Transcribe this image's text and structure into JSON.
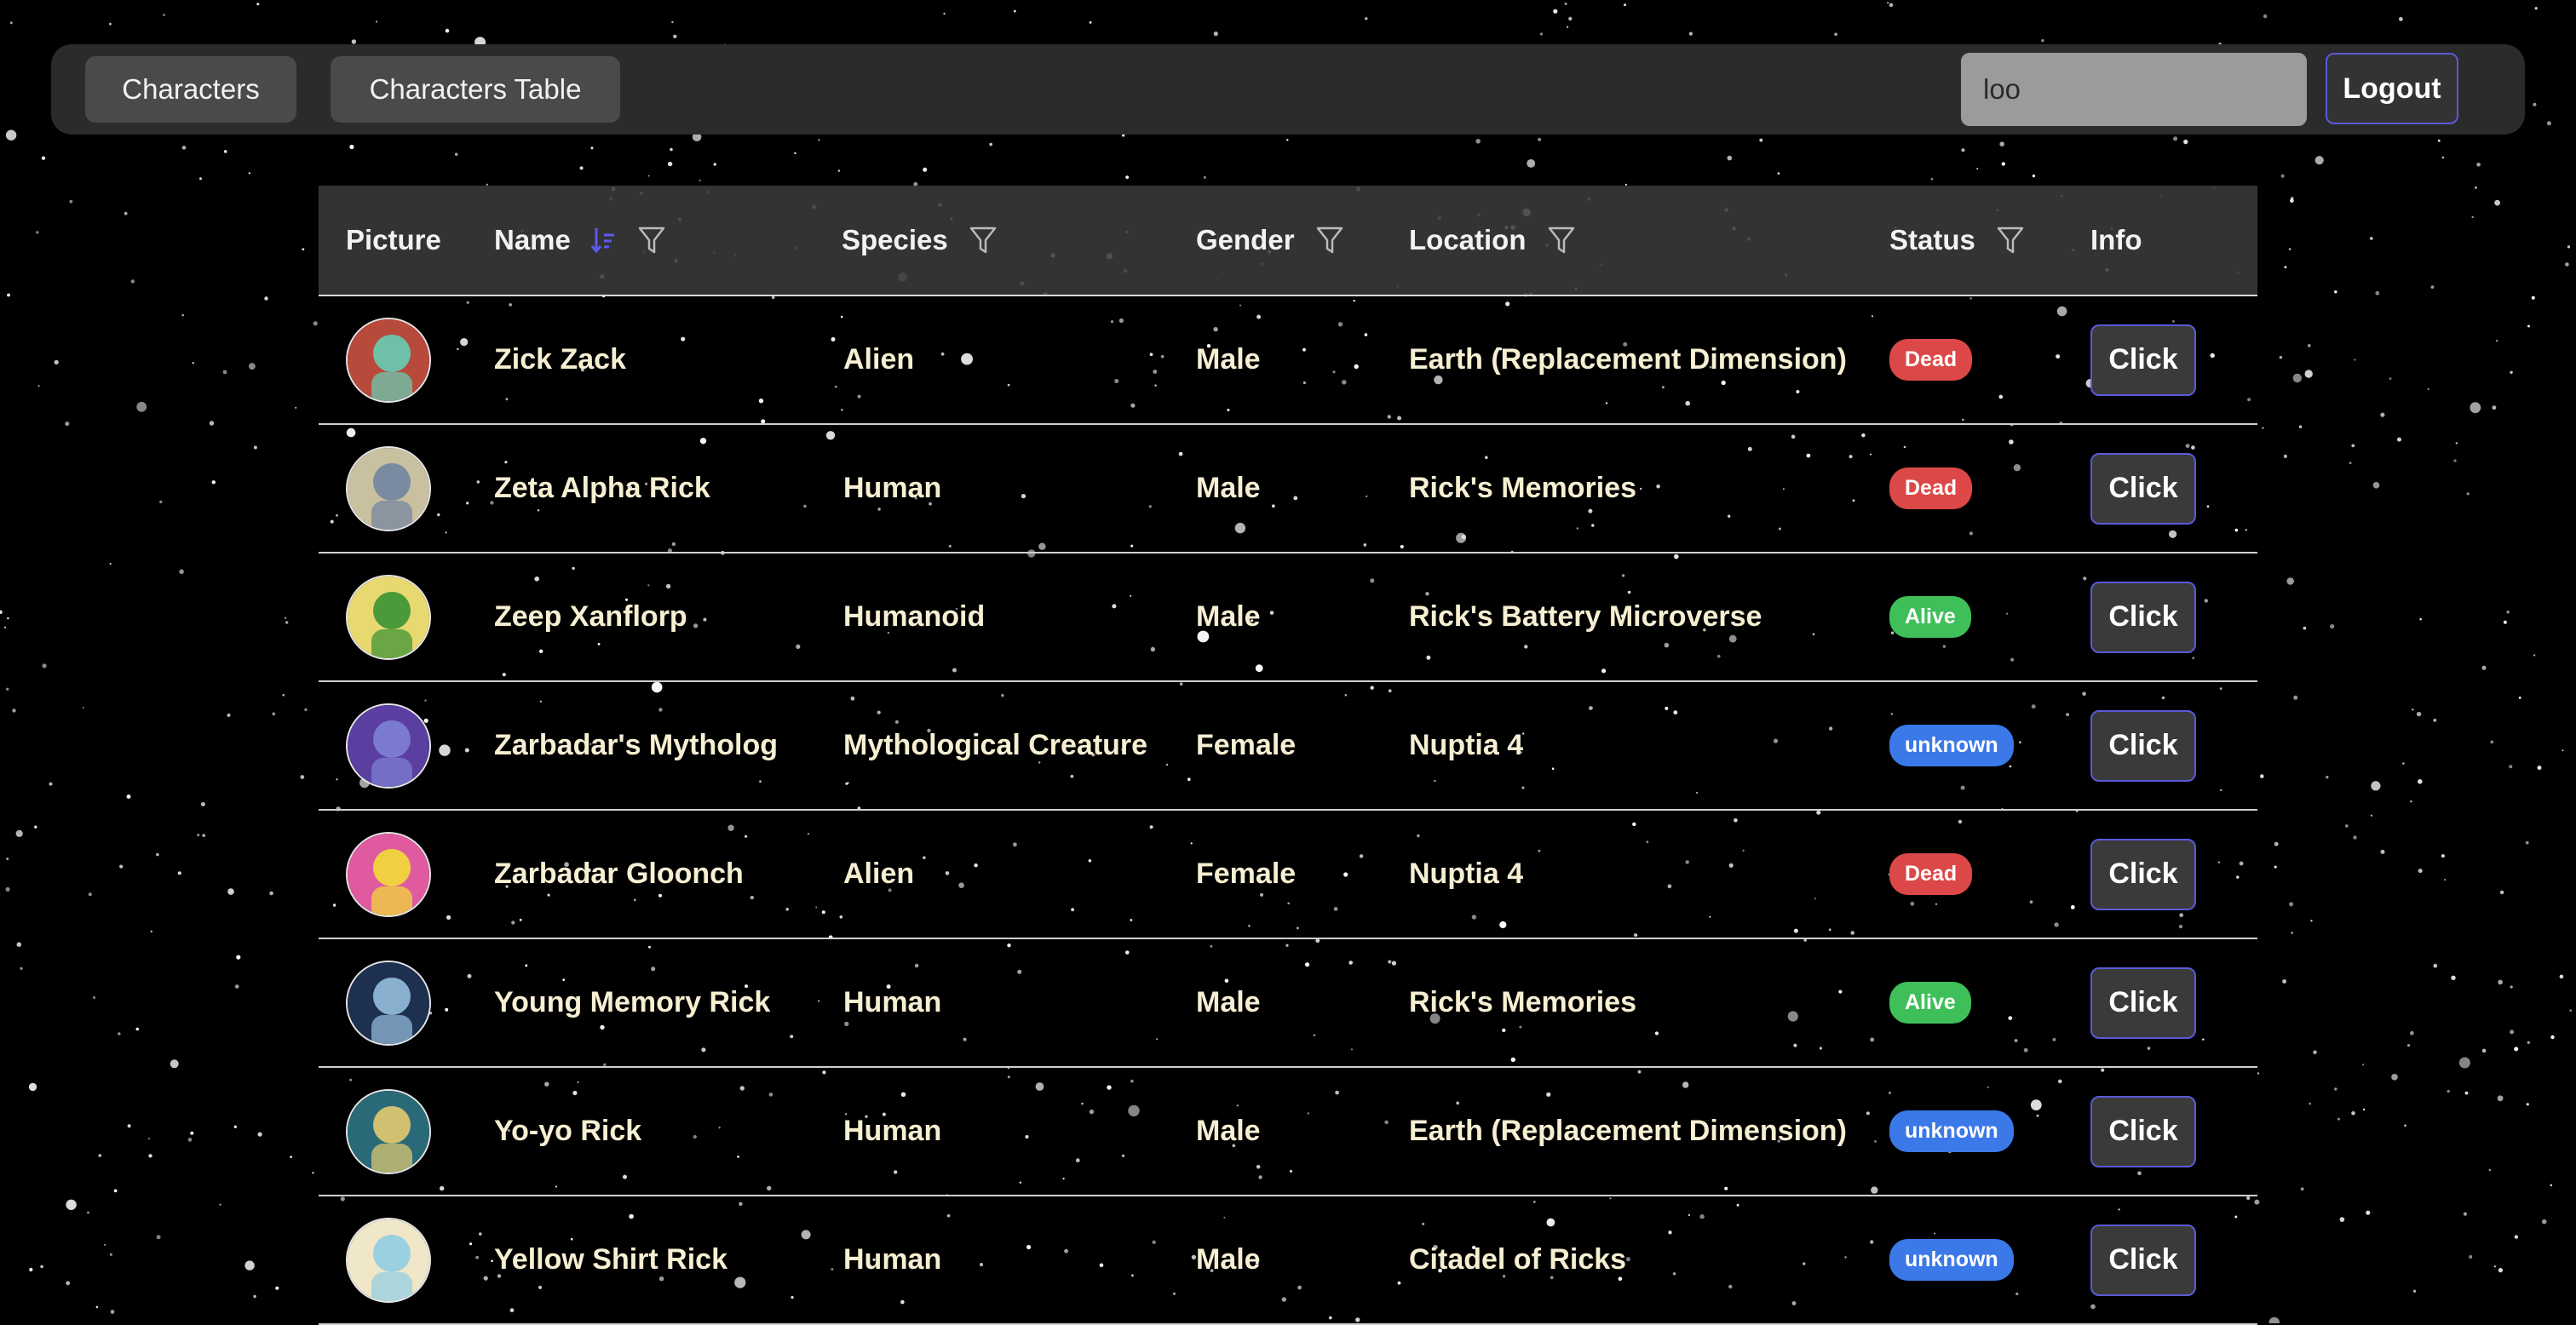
{
  "nav": {
    "characters_label": "Characters",
    "table_label": "Characters Table",
    "search_value": "loo",
    "logout_label": "Logout"
  },
  "table": {
    "headers": {
      "picture": "Picture",
      "name": "Name",
      "species": "Species",
      "gender": "Gender",
      "location": "Location",
      "status": "Status",
      "info": "Info"
    },
    "sort": {
      "column": "name",
      "direction": "descending",
      "icon": "sort-descending-icon"
    },
    "status_colors": {
      "Dead": "#dc4848",
      "Alive": "#3fbf5a",
      "unknown": "#3b78e8"
    },
    "rows": [
      {
        "name": "Zick Zack",
        "species": "Alien",
        "gender": "Male",
        "location": "Earth (Replacement Dimension)",
        "status": "Dead",
        "info": "Click"
      },
      {
        "name": "Zeta Alpha Rick",
        "species": "Human",
        "gender": "Male",
        "location": "Rick's Memories",
        "status": "Dead",
        "info": "Click"
      },
      {
        "name": "Zeep Xanflorp",
        "species": "Humanoid",
        "gender": "Male",
        "location": "Rick's Battery Microverse",
        "status": "Alive",
        "info": "Click"
      },
      {
        "name": "Zarbadar's Mytholog",
        "species": "Mythological Creature",
        "gender": "Female",
        "location": "Nuptia 4",
        "status": "unknown",
        "info": "Click"
      },
      {
        "name": "Zarbadar Gloonch",
        "species": "Alien",
        "gender": "Female",
        "location": "Nuptia 4",
        "status": "Dead",
        "info": "Click"
      },
      {
        "name": "Young Memory Rick",
        "species": "Human",
        "gender": "Male",
        "location": "Rick's Memories",
        "status": "Alive",
        "info": "Click"
      },
      {
        "name": "Yo-yo Rick",
        "species": "Human",
        "gender": "Male",
        "location": "Earth (Replacement Dimension)",
        "status": "unknown",
        "info": "Click"
      },
      {
        "name": "Yellow Shirt Rick",
        "species": "Human",
        "gender": "Male",
        "location": "Citadel of Ricks",
        "status": "unknown",
        "info": "Click"
      }
    ]
  }
}
